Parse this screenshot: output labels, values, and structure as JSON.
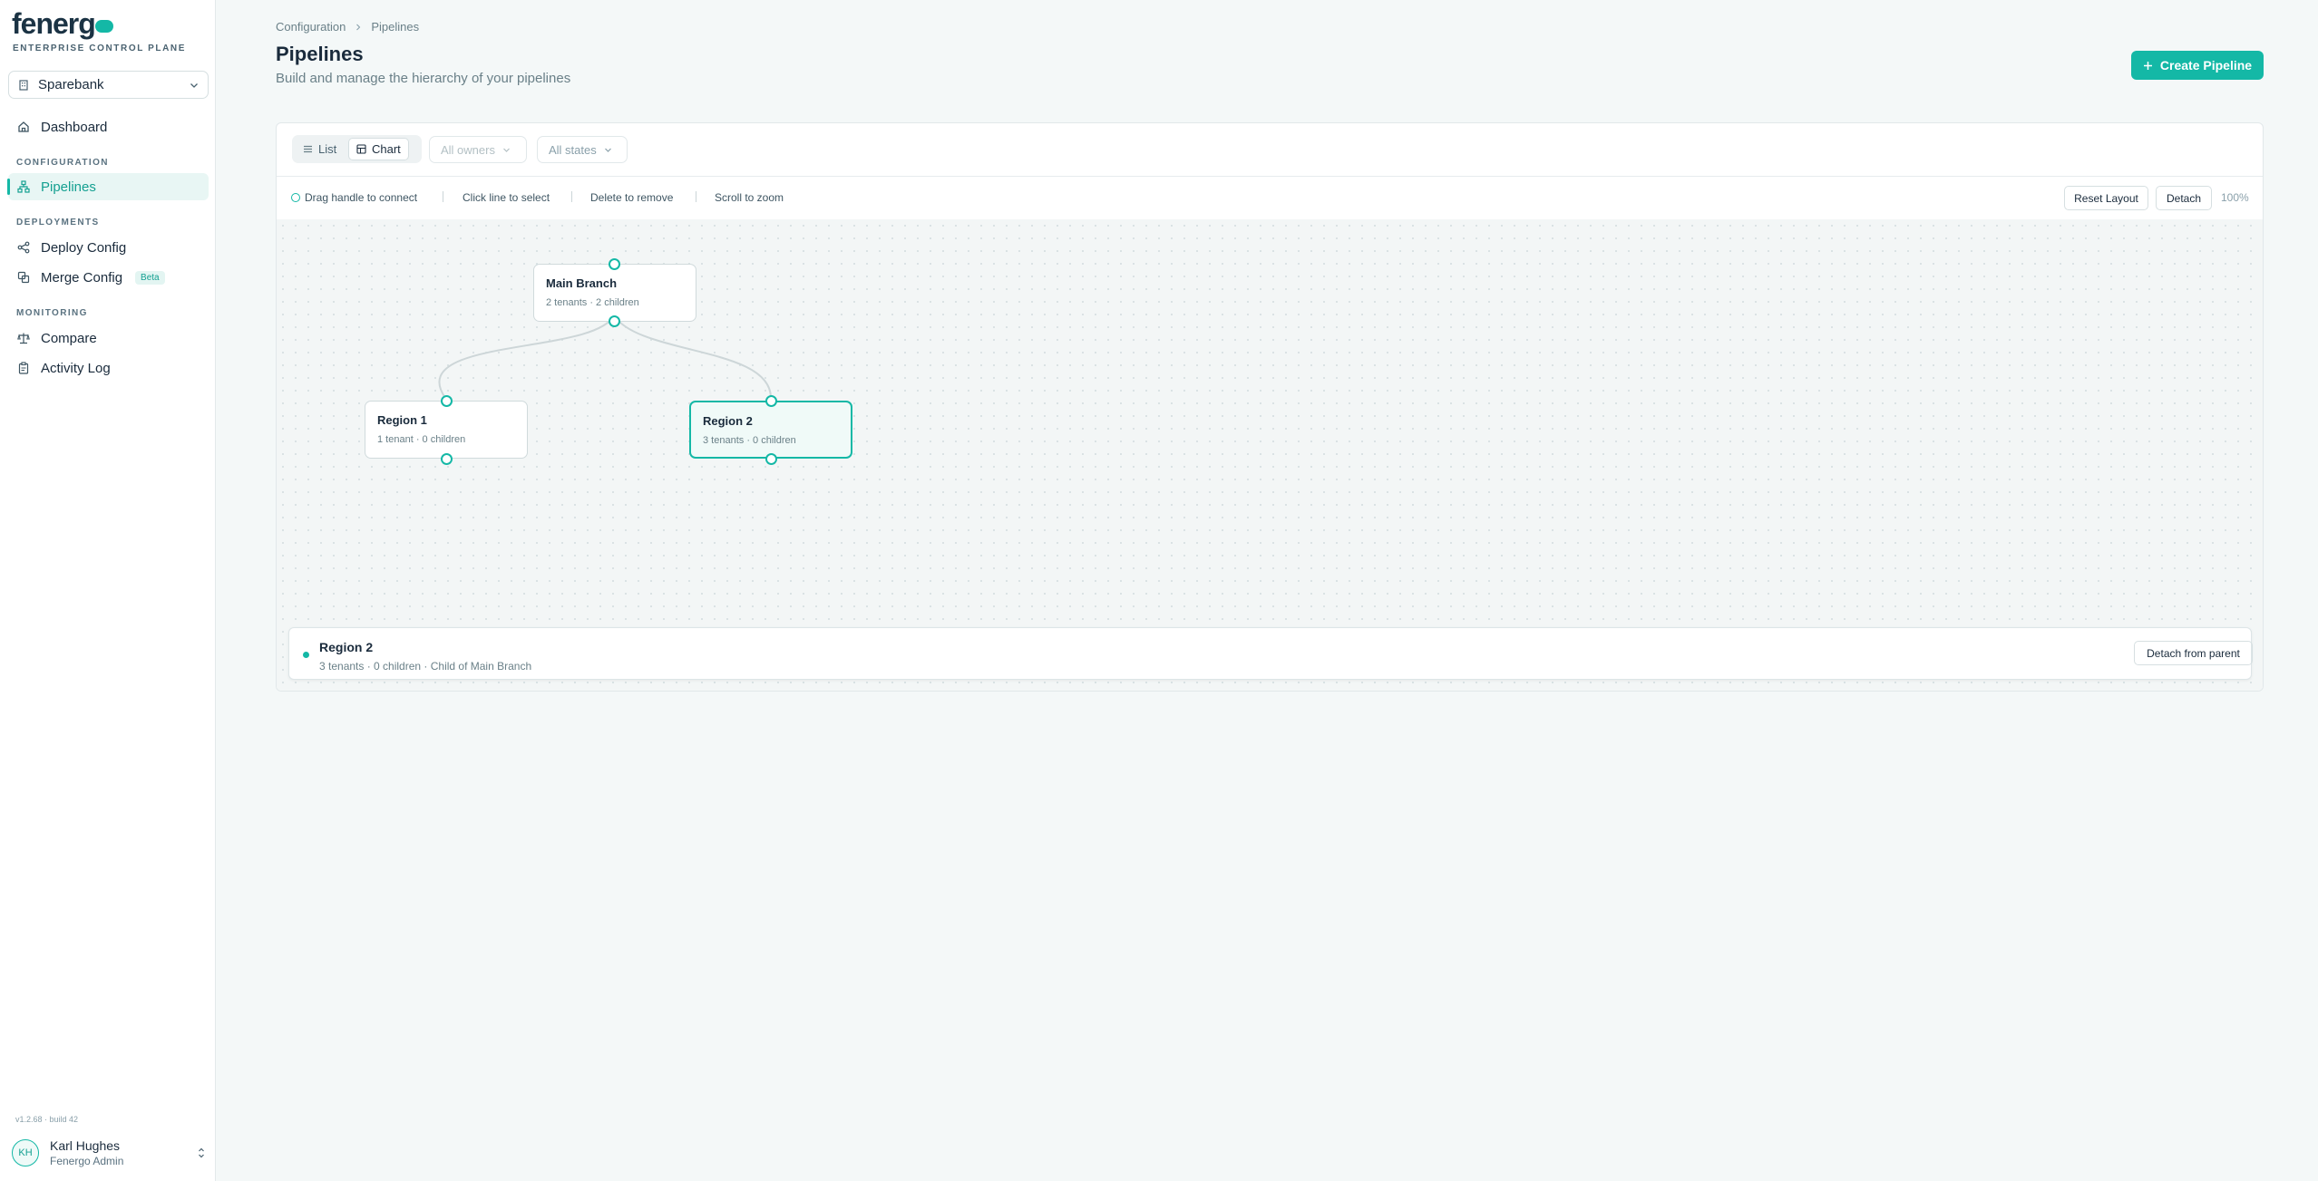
{
  "brand": {
    "logo_text": "fenerg",
    "tagline": "ENTERPRISE CONTROL PLANE",
    "accent": "#14b8a6"
  },
  "org_selector": {
    "value": "Sparebank",
    "icon": "building-icon"
  },
  "nav": {
    "dashboard": "Dashboard",
    "section_configuration": "CONFIGURATION",
    "pipelines": "Pipelines",
    "section_deployments": "DEPLOYMENTS",
    "deploy_config": "Deploy Config",
    "merge_config": "Merge Config",
    "merge_badge": "Beta",
    "section_monitoring": "MONITORING",
    "compare": "Compare",
    "activity_log": "Activity Log"
  },
  "version": "v1.2.68 · build 42",
  "user": {
    "initials": "KH",
    "name": "Karl Hughes",
    "role": "Fenergo Admin"
  },
  "breadcrumb": [
    "Configuration",
    "Pipelines"
  ],
  "page": {
    "title": "Pipelines",
    "subtitle": "Build and manage the hierarchy of your pipelines",
    "create_label": "Create Pipeline"
  },
  "toolbar": {
    "view_list": "List",
    "view_chart": "Chart",
    "active_view": "Chart",
    "owners_filter": "All owners",
    "states_filter": "All states"
  },
  "hints": [
    "Drag handle to connect",
    "Click line to select",
    "Delete to remove",
    "Scroll to zoom"
  ],
  "chart_controls": {
    "reset": "Reset Layout",
    "detach": "Detach",
    "zoom": "100%"
  },
  "nodes": [
    {
      "id": "main",
      "title": "Main Branch",
      "subtitle": "2 tenants · 2 children",
      "selected": false
    },
    {
      "id": "r1",
      "title": "Region 1",
      "subtitle": "1 tenant · 0 children",
      "selected": false
    },
    {
      "id": "r2",
      "title": "Region 2",
      "subtitle": "3 tenants · 0 children",
      "selected": true
    }
  ],
  "edges": [
    {
      "from": "main",
      "to": "r1"
    },
    {
      "from": "main",
      "to": "r2"
    }
  ],
  "selection": {
    "title": "Region 2",
    "subtitle": "3 tenants · 0 children · Child of Main Branch",
    "action": "Detach from parent"
  }
}
